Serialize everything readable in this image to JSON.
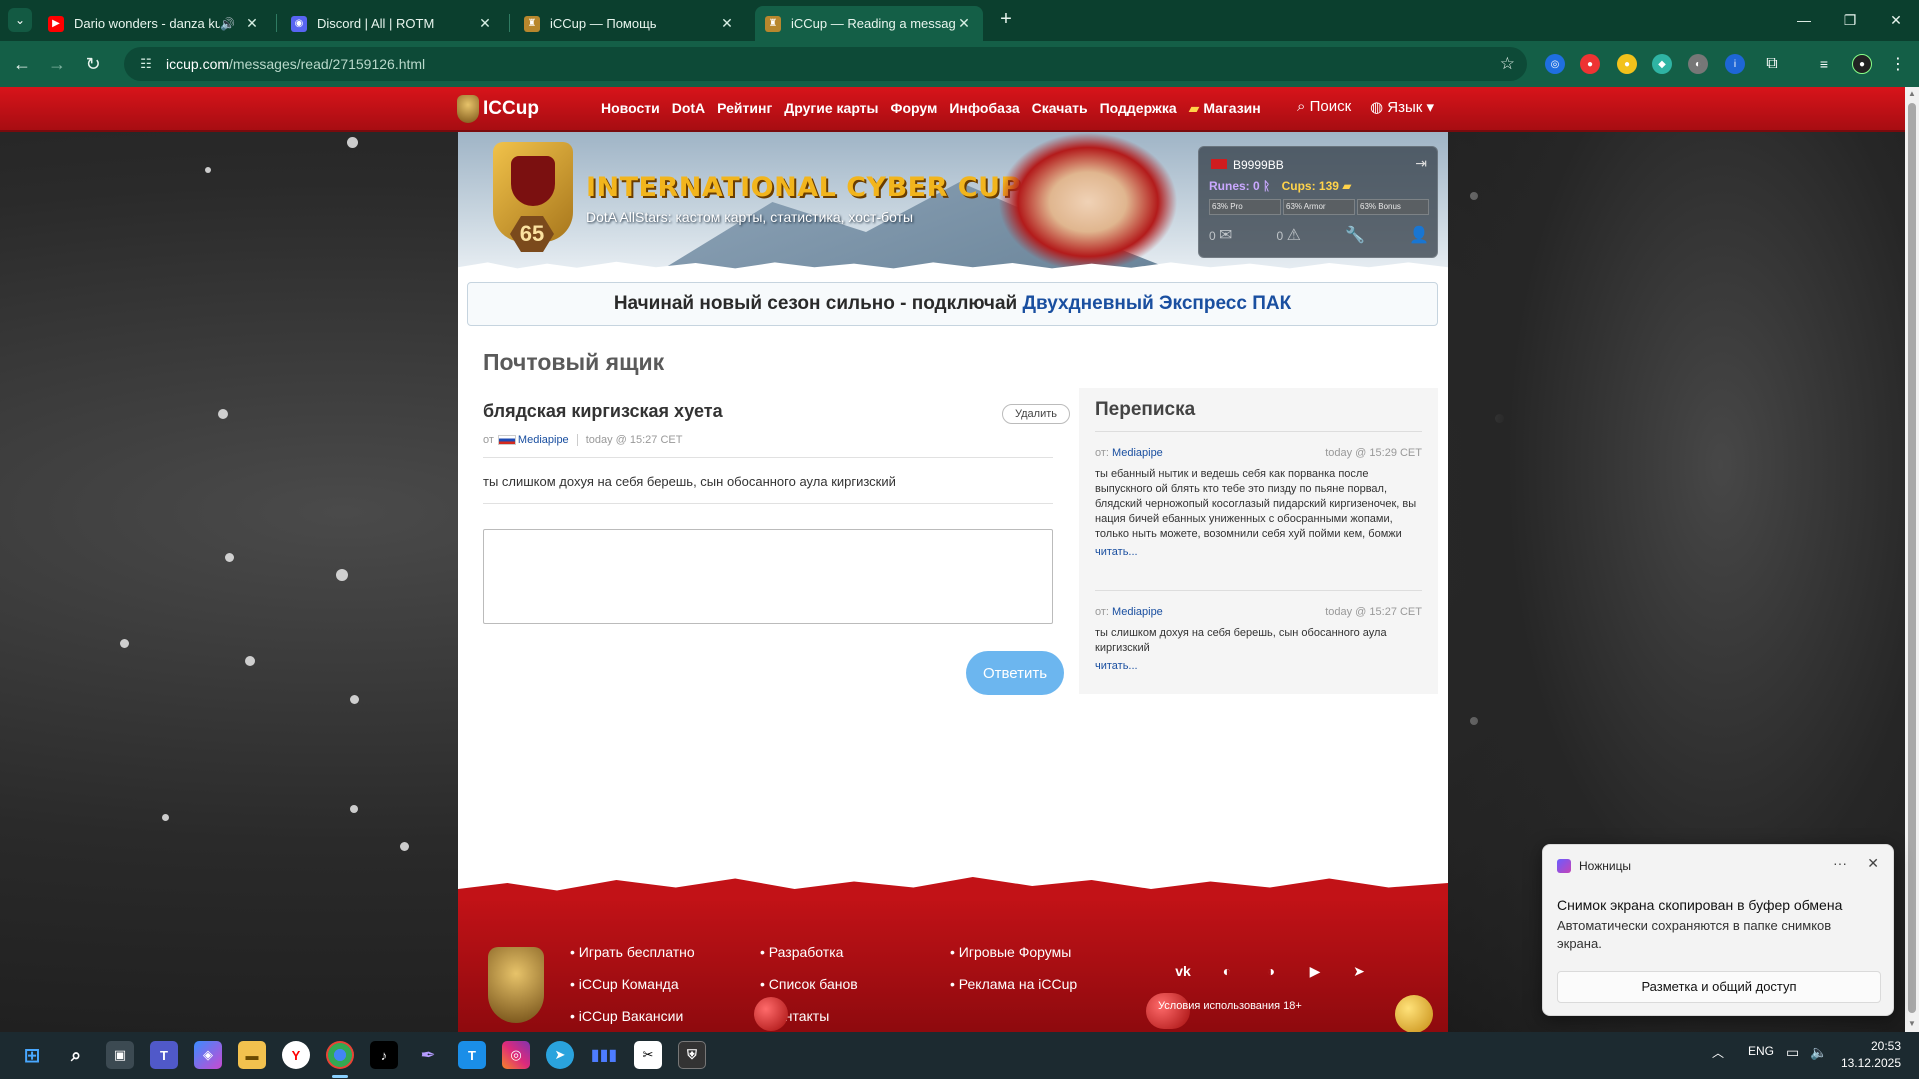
{
  "browser": {
    "tabs": [
      {
        "title": "Dario wonders - danza kudu",
        "favicon": "youtube-icon",
        "color": "#ff0000",
        "audio": true
      },
      {
        "title": "Discord | All | ROTM",
        "favicon": "discord-icon",
        "color": "#5865f2",
        "audio": false
      },
      {
        "title": "iCCup — Помощь",
        "favicon": "iccup-icon",
        "color": "#b8872d",
        "audio": false
      },
      {
        "title": "iCCup — Reading a message fro",
        "favicon": "iccup-icon",
        "color": "#b8872d",
        "audio": false
      }
    ],
    "url_host": "iccup.com",
    "url_path": "/messages/read/27159126.html"
  },
  "site": {
    "logo": "ICCup",
    "menu": [
      "Новости",
      "DotA",
      "Рейтинг",
      "Другие карты",
      "Форум",
      "Инфобаза",
      "Скачать",
      "Поддержка",
      "Магазин"
    ],
    "search_label": "Поиск",
    "lang_label": "Язык"
  },
  "banner": {
    "title": "INTERNATIONAL CYBER CUP",
    "subtitle": "DotA AllStars: кастом карты, статистика, хост-боты",
    "level": "65"
  },
  "user": {
    "name": "B9999BB",
    "runes_label": "Runes: 0",
    "cups_label": "Cups: 139",
    "bars": [
      "63% Pro",
      "63% Armor",
      "63% Bonus"
    ],
    "messages_count": "0",
    "warnings_count": "0"
  },
  "promo": {
    "text": "Начинай новый сезон сильно - подключай",
    "link": "Двухдневный Экспресс ПАК"
  },
  "mailbox": {
    "title": "Почтовый ящик",
    "message": {
      "subject": "блядская киргизская хуета",
      "delete_label": "Удалить",
      "from_label": "от",
      "sender": "Mediapipe",
      "time": "today @ 15:27 CET",
      "body": "ты слишком дохуя на себя берешь, сын обосанного аула киргизский"
    },
    "reply_label": "Ответить"
  },
  "correspondence": {
    "title": "Переписка",
    "items": [
      {
        "from_label": "от:",
        "sender": "Mediapipe",
        "time": "today @ 15:29 CET",
        "text": "ты ебанный нытик и ведешь себя как порванка после выпускного ой блять кто тебе это пизду по пьяне порвал, блядский черножопый косоглазый пидарский киргизеночек, вы нация бичей ебанных униженных с обосранными жопами, только ныть можете, возомнили себя хуй пойми кем, бомжи",
        "more": "читать..."
      },
      {
        "from_label": "от:",
        "sender": "Mediapipe",
        "time": "today @ 15:27 CET",
        "text": "ты слишком дохуя на себя берешь, сын обосанного аула киргизский",
        "more": "читать..."
      }
    ]
  },
  "footer": {
    "col1": [
      "Играть бесплатно",
      "iCCup Команда",
      "iCCup Вакансии"
    ],
    "col2": [
      "Разработка",
      "Список банов",
      "Контакты"
    ],
    "col3": [
      "Игровые Форумы",
      "Реклама на iCCup"
    ],
    "social": [
      "vk-icon",
      "discord-icon",
      "discord-alt-icon",
      "youtube-icon",
      "telegram-icon"
    ],
    "terms": "Условия использования 18+"
  },
  "toast": {
    "app": "Ножницы",
    "title": "Снимок экрана скопирован в буфер обмена",
    "text": "Автоматически сохраняются в папке снимков экрана.",
    "action": "Разметка и общий доступ"
  },
  "taskbar": {
    "lang": "ENG",
    "time": "20:53",
    "date": "13.12.2025"
  }
}
